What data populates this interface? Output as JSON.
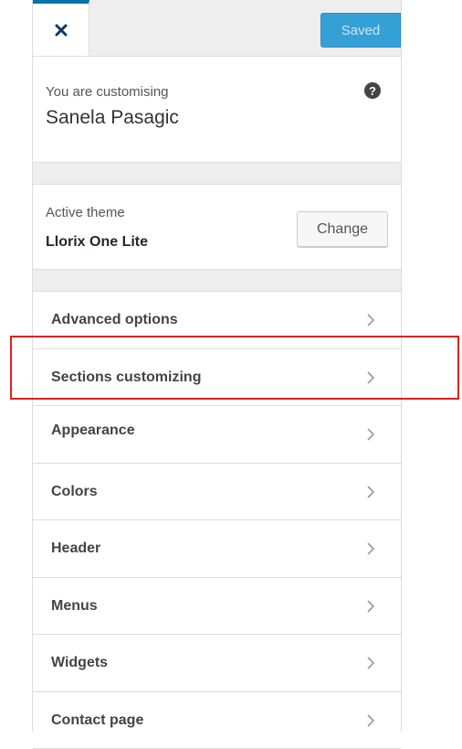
{
  "header": {
    "saved_label": "Saved"
  },
  "info": {
    "customising_label": "You are customising",
    "site_name": "Sanela Pasagic",
    "help_glyph": "?"
  },
  "theme": {
    "label": "Active theme",
    "name": "Llorix One Lite",
    "change_label": "Change"
  },
  "menu": {
    "items": [
      {
        "label": "Advanced options"
      },
      {
        "label": "Sections customizing"
      },
      {
        "label": "Appearance"
      },
      {
        "label": "Colors"
      },
      {
        "label": "Header"
      },
      {
        "label": "Menus"
      },
      {
        "label": "Widgets"
      },
      {
        "label": "Contact page"
      }
    ]
  },
  "colors": {
    "accent": "#0073aa",
    "saved_button": "#34a0d6",
    "highlight": "#e02020"
  },
  "icons": {
    "close": "close-icon",
    "help": "help-icon",
    "chevron": "chevron-right-icon"
  }
}
